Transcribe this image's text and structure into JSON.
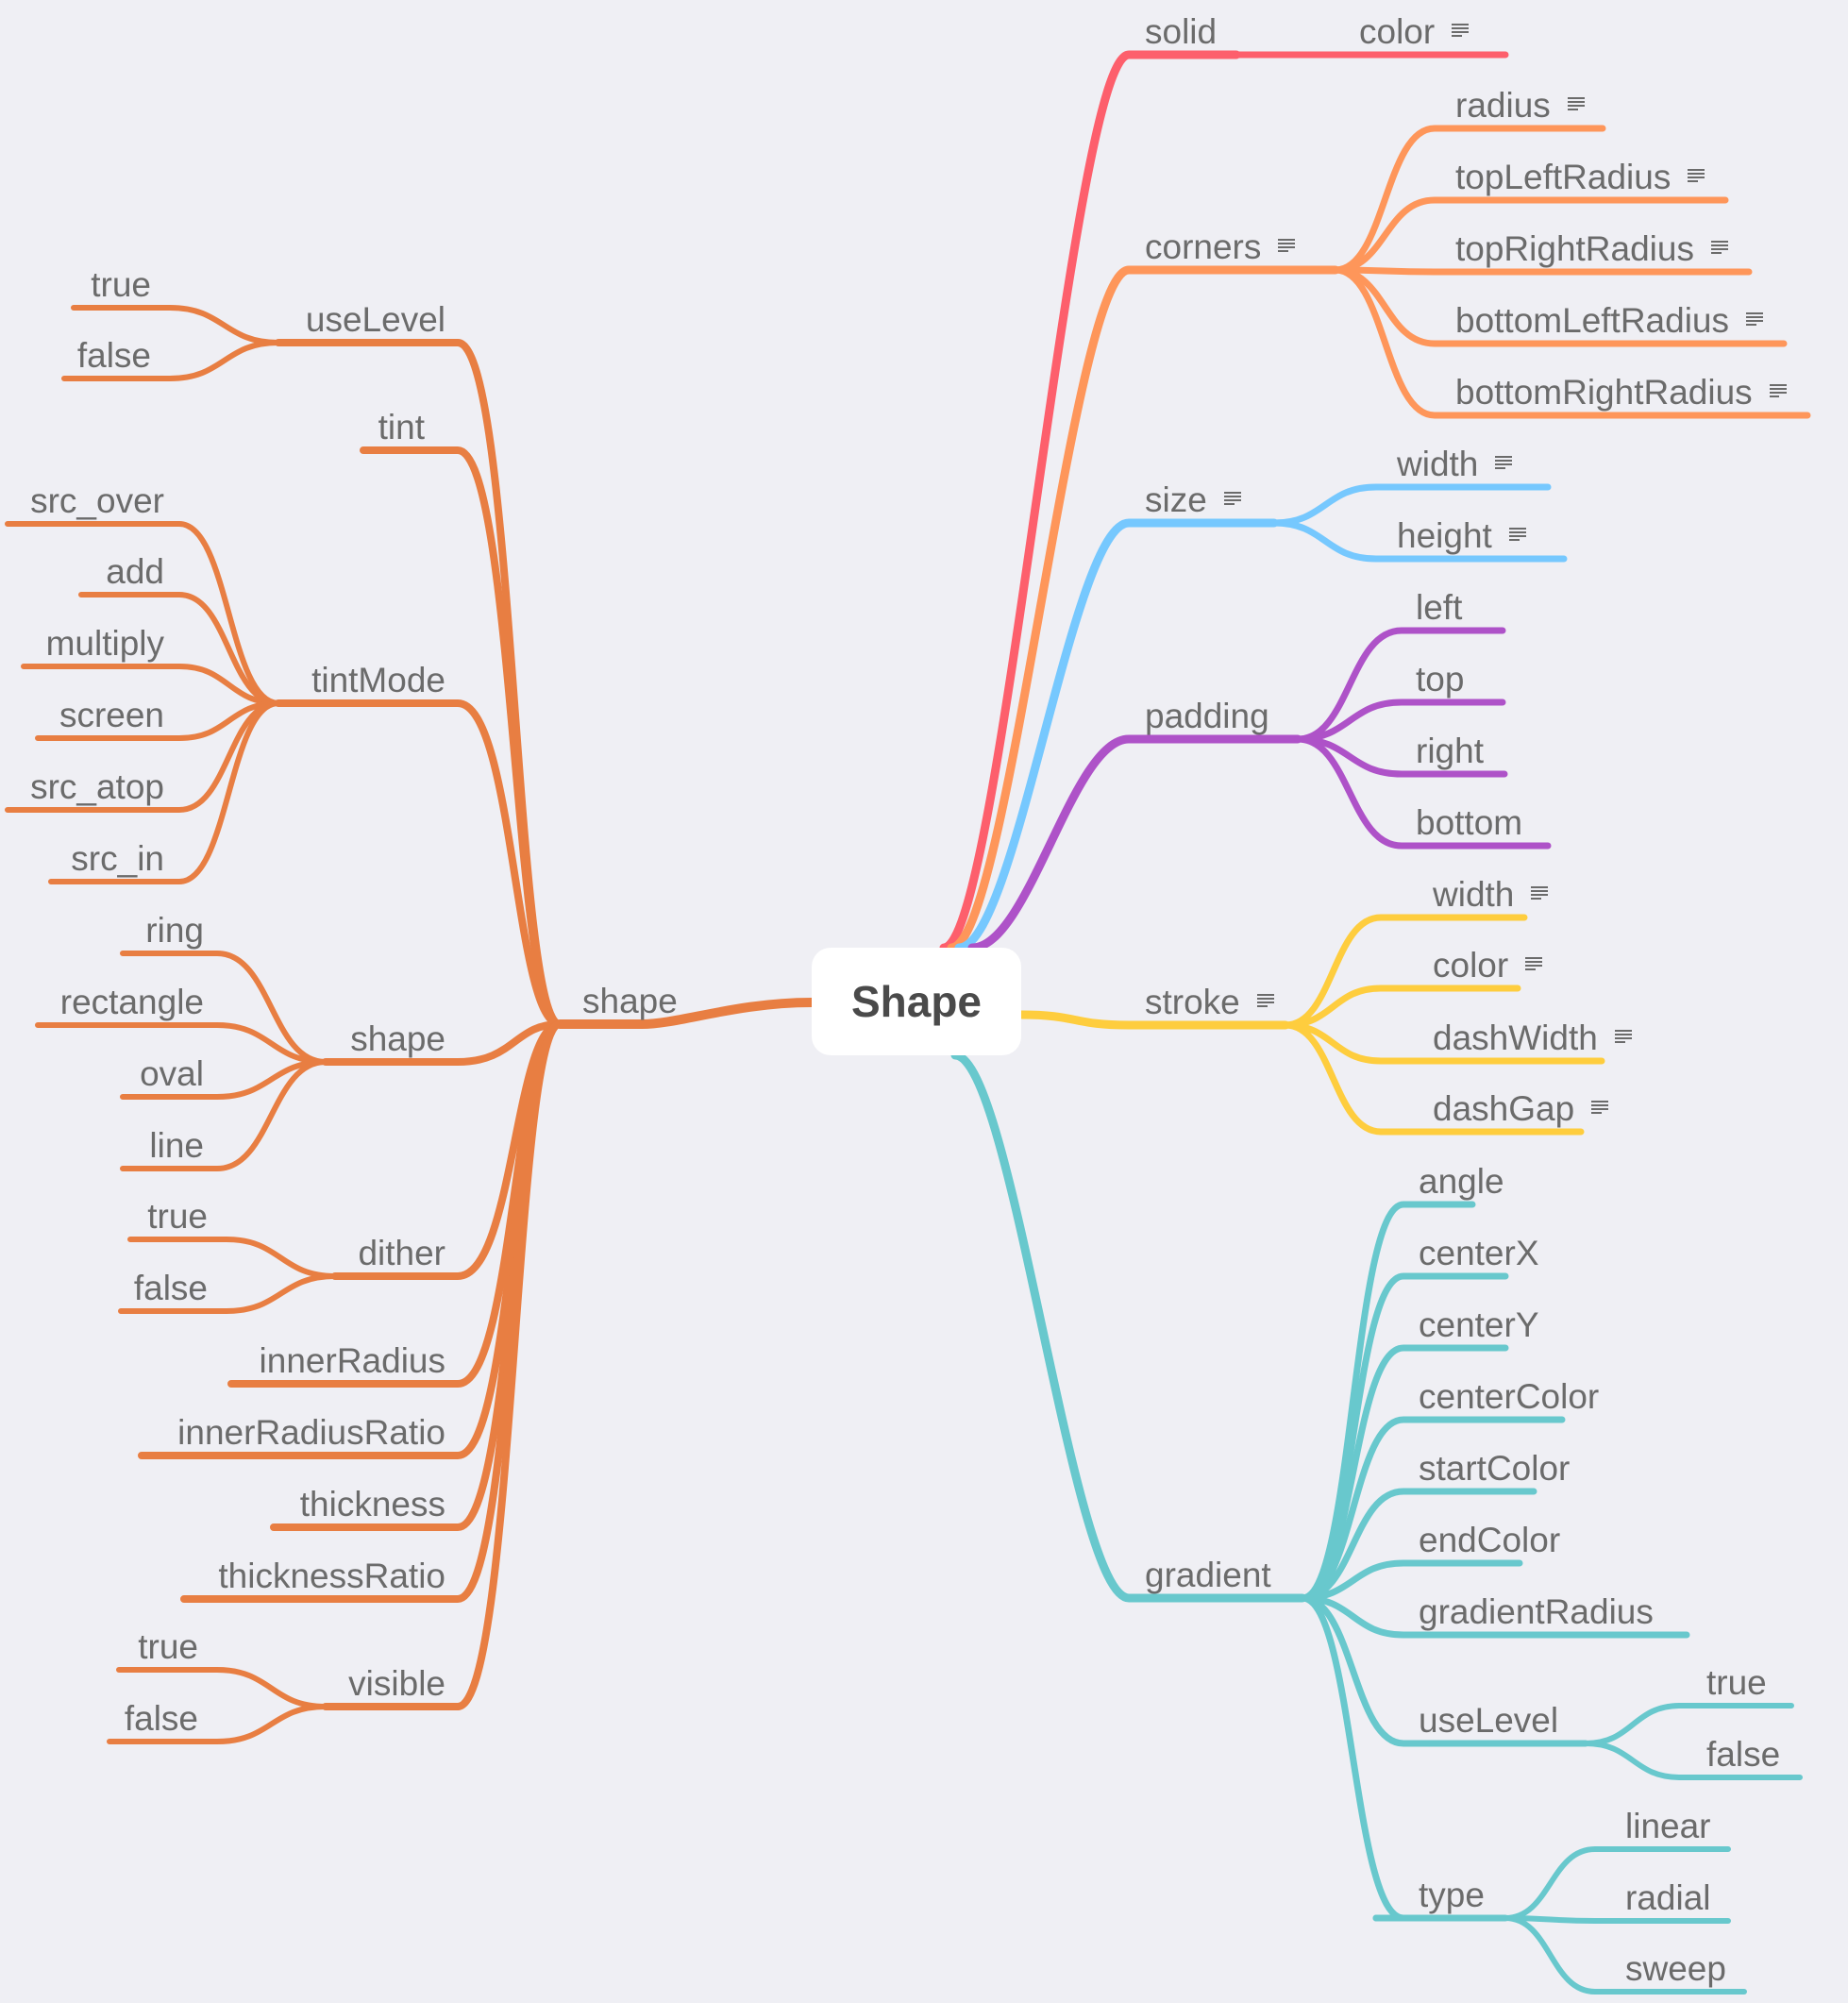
{
  "root": {
    "label": "Shape"
  },
  "colors": {
    "background": "#efeff4",
    "text": "#6b6b6b",
    "solid": "#fd5f6c",
    "corners": "#fe965a",
    "size": "#76c8fe",
    "padding": "#ae52c8",
    "stroke": "#fecd3e",
    "gradient": "#68c8cd",
    "shape": "#e87e42"
  },
  "right_branches": [
    {
      "label": "solid",
      "color_key": "solid",
      "note": false,
      "children": [
        {
          "label": "color",
          "note": true
        }
      ]
    },
    {
      "label": "corners",
      "color_key": "corners",
      "note": true,
      "children": [
        {
          "label": "radius",
          "note": true
        },
        {
          "label": "topLeftRadius",
          "note": true
        },
        {
          "label": "topRightRadius",
          "note": true
        },
        {
          "label": "bottomLeftRadius",
          "note": true
        },
        {
          "label": "bottomRightRadius",
          "note": true
        }
      ]
    },
    {
      "label": "size",
      "color_key": "size",
      "note": true,
      "children": [
        {
          "label": "width",
          "note": true
        },
        {
          "label": "height",
          "note": true
        }
      ]
    },
    {
      "label": "padding",
      "color_key": "padding",
      "note": false,
      "children": [
        {
          "label": "left"
        },
        {
          "label": "top"
        },
        {
          "label": "right"
        },
        {
          "label": "bottom"
        }
      ]
    },
    {
      "label": "stroke",
      "color_key": "stroke",
      "note": true,
      "children": [
        {
          "label": "width",
          "note": true
        },
        {
          "label": "color",
          "note": true
        },
        {
          "label": "dashWidth",
          "note": true
        },
        {
          "label": "dashGap",
          "note": true
        }
      ]
    },
    {
      "label": "gradient",
      "color_key": "gradient",
      "note": false,
      "children": [
        {
          "label": "angle"
        },
        {
          "label": "centerX"
        },
        {
          "label": "centerY"
        },
        {
          "label": "centerColor"
        },
        {
          "label": "startColor"
        },
        {
          "label": "endColor"
        },
        {
          "label": "gradientRadius"
        },
        {
          "label": "useLevel",
          "children": [
            {
              "label": "true"
            },
            {
              "label": "false"
            }
          ]
        },
        {
          "label": "type",
          "children": [
            {
              "label": "linear"
            },
            {
              "label": "radial"
            },
            {
              "label": "sweep"
            }
          ]
        }
      ]
    }
  ],
  "left_branch": {
    "label": "shape",
    "color_key": "shape",
    "children": [
      {
        "label": "useLevel",
        "children": [
          {
            "label": "true"
          },
          {
            "label": "false"
          }
        ]
      },
      {
        "label": "tint"
      },
      {
        "label": "tintMode",
        "children": [
          {
            "label": "src_over"
          },
          {
            "label": "add"
          },
          {
            "label": "multiply"
          },
          {
            "label": "screen"
          },
          {
            "label": "src_atop"
          },
          {
            "label": "src_in"
          }
        ]
      },
      {
        "label": "shape",
        "children": [
          {
            "label": "ring"
          },
          {
            "label": "rectangle"
          },
          {
            "label": "oval"
          },
          {
            "label": "line"
          }
        ]
      },
      {
        "label": "dither",
        "children": [
          {
            "label": "true"
          },
          {
            "label": "false"
          }
        ]
      },
      {
        "label": "innerRadius"
      },
      {
        "label": "innerRadiusRatio"
      },
      {
        "label": "thickness"
      },
      {
        "label": "thicknessRatio"
      },
      {
        "label": "visible",
        "children": [
          {
            "label": "true"
          },
          {
            "label": "false"
          }
        ]
      }
    ]
  }
}
